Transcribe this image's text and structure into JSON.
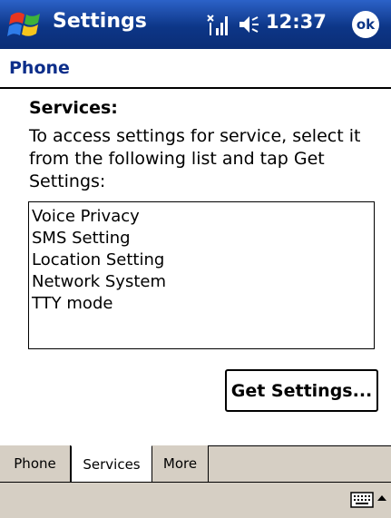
{
  "titlebar": {
    "app_title": "Settings",
    "time": "12:37",
    "ok_label": "ok",
    "start_icon": "windows-flag-icon",
    "signal_icon": "signal-icon",
    "volume_icon": "speaker-icon"
  },
  "page": {
    "title": "Phone"
  },
  "services": {
    "heading": "Services:",
    "instructions": "To access settings for service, select it from the following list and tap Get Settings:",
    "items": [
      {
        "label": "Voice Privacy"
      },
      {
        "label": "SMS Setting"
      },
      {
        "label": "Location Setting"
      },
      {
        "label": "Network System"
      },
      {
        "label": "TTY mode"
      }
    ],
    "button_label": "Get Settings..."
  },
  "tabs": [
    {
      "label": "Phone",
      "active": false
    },
    {
      "label": "Services",
      "active": true
    },
    {
      "label": "More",
      "active": false
    }
  ],
  "bottombar": {
    "keyboard_icon": "keyboard-icon",
    "sip_arrow_icon": "up-arrow-icon"
  },
  "colors": {
    "titlebar_blue": "#0d3687",
    "header_text": "#0d2e8a",
    "chrome_gray": "#d6cfc4"
  }
}
